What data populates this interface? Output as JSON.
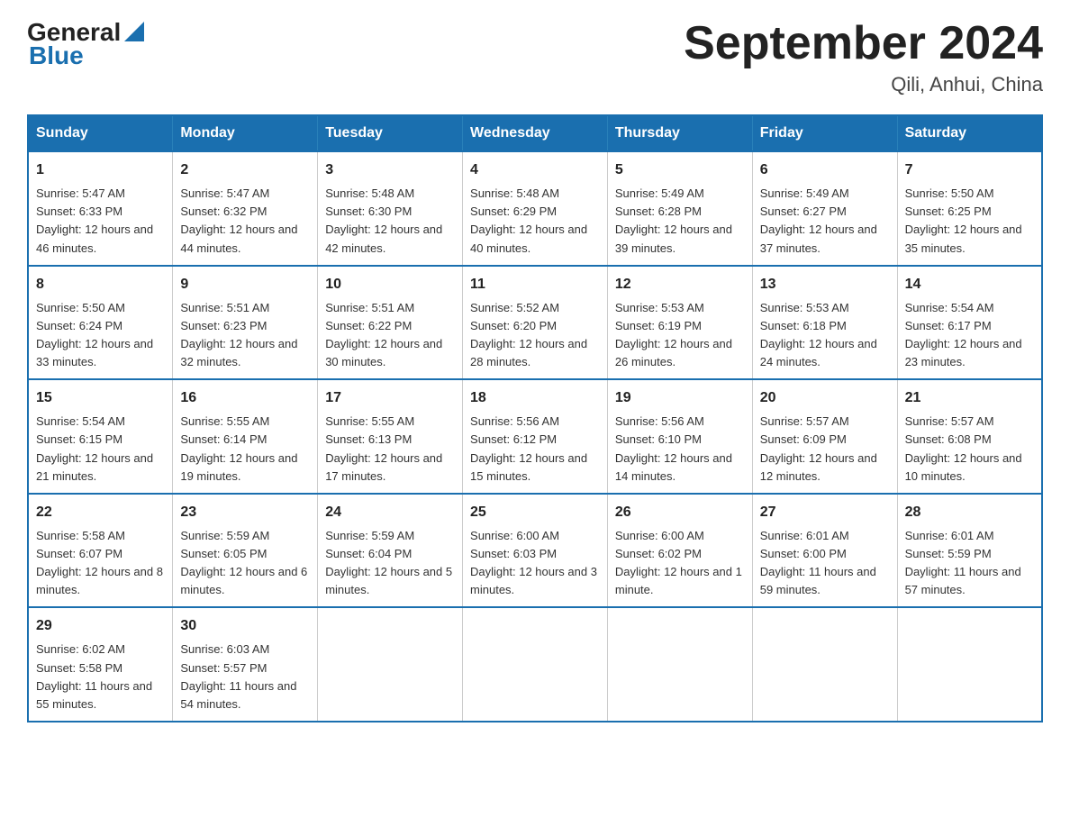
{
  "logo": {
    "text_general": "General",
    "text_blue": "Blue"
  },
  "title": "September 2024",
  "subtitle": "Qili, Anhui, China",
  "days_header": [
    "Sunday",
    "Monday",
    "Tuesday",
    "Wednesday",
    "Thursday",
    "Friday",
    "Saturday"
  ],
  "weeks": [
    [
      {
        "day": "1",
        "sunrise": "5:47 AM",
        "sunset": "6:33 PM",
        "daylight": "12 hours and 46 minutes."
      },
      {
        "day": "2",
        "sunrise": "5:47 AM",
        "sunset": "6:32 PM",
        "daylight": "12 hours and 44 minutes."
      },
      {
        "day": "3",
        "sunrise": "5:48 AM",
        "sunset": "6:30 PM",
        "daylight": "12 hours and 42 minutes."
      },
      {
        "day": "4",
        "sunrise": "5:48 AM",
        "sunset": "6:29 PM",
        "daylight": "12 hours and 40 minutes."
      },
      {
        "day": "5",
        "sunrise": "5:49 AM",
        "sunset": "6:28 PM",
        "daylight": "12 hours and 39 minutes."
      },
      {
        "day": "6",
        "sunrise": "5:49 AM",
        "sunset": "6:27 PM",
        "daylight": "12 hours and 37 minutes."
      },
      {
        "day": "7",
        "sunrise": "5:50 AM",
        "sunset": "6:25 PM",
        "daylight": "12 hours and 35 minutes."
      }
    ],
    [
      {
        "day": "8",
        "sunrise": "5:50 AM",
        "sunset": "6:24 PM",
        "daylight": "12 hours and 33 minutes."
      },
      {
        "day": "9",
        "sunrise": "5:51 AM",
        "sunset": "6:23 PM",
        "daylight": "12 hours and 32 minutes."
      },
      {
        "day": "10",
        "sunrise": "5:51 AM",
        "sunset": "6:22 PM",
        "daylight": "12 hours and 30 minutes."
      },
      {
        "day": "11",
        "sunrise": "5:52 AM",
        "sunset": "6:20 PM",
        "daylight": "12 hours and 28 minutes."
      },
      {
        "day": "12",
        "sunrise": "5:53 AM",
        "sunset": "6:19 PM",
        "daylight": "12 hours and 26 minutes."
      },
      {
        "day": "13",
        "sunrise": "5:53 AM",
        "sunset": "6:18 PM",
        "daylight": "12 hours and 24 minutes."
      },
      {
        "day": "14",
        "sunrise": "5:54 AM",
        "sunset": "6:17 PM",
        "daylight": "12 hours and 23 minutes."
      }
    ],
    [
      {
        "day": "15",
        "sunrise": "5:54 AM",
        "sunset": "6:15 PM",
        "daylight": "12 hours and 21 minutes."
      },
      {
        "day": "16",
        "sunrise": "5:55 AM",
        "sunset": "6:14 PM",
        "daylight": "12 hours and 19 minutes."
      },
      {
        "day": "17",
        "sunrise": "5:55 AM",
        "sunset": "6:13 PM",
        "daylight": "12 hours and 17 minutes."
      },
      {
        "day": "18",
        "sunrise": "5:56 AM",
        "sunset": "6:12 PM",
        "daylight": "12 hours and 15 minutes."
      },
      {
        "day": "19",
        "sunrise": "5:56 AM",
        "sunset": "6:10 PM",
        "daylight": "12 hours and 14 minutes."
      },
      {
        "day": "20",
        "sunrise": "5:57 AM",
        "sunset": "6:09 PM",
        "daylight": "12 hours and 12 minutes."
      },
      {
        "day": "21",
        "sunrise": "5:57 AM",
        "sunset": "6:08 PM",
        "daylight": "12 hours and 10 minutes."
      }
    ],
    [
      {
        "day": "22",
        "sunrise": "5:58 AM",
        "sunset": "6:07 PM",
        "daylight": "12 hours and 8 minutes."
      },
      {
        "day": "23",
        "sunrise": "5:59 AM",
        "sunset": "6:05 PM",
        "daylight": "12 hours and 6 minutes."
      },
      {
        "day": "24",
        "sunrise": "5:59 AM",
        "sunset": "6:04 PM",
        "daylight": "12 hours and 5 minutes."
      },
      {
        "day": "25",
        "sunrise": "6:00 AM",
        "sunset": "6:03 PM",
        "daylight": "12 hours and 3 minutes."
      },
      {
        "day": "26",
        "sunrise": "6:00 AM",
        "sunset": "6:02 PM",
        "daylight": "12 hours and 1 minute."
      },
      {
        "day": "27",
        "sunrise": "6:01 AM",
        "sunset": "6:00 PM",
        "daylight": "11 hours and 59 minutes."
      },
      {
        "day": "28",
        "sunrise": "6:01 AM",
        "sunset": "5:59 PM",
        "daylight": "11 hours and 57 minutes."
      }
    ],
    [
      {
        "day": "29",
        "sunrise": "6:02 AM",
        "sunset": "5:58 PM",
        "daylight": "11 hours and 55 minutes."
      },
      {
        "day": "30",
        "sunrise": "6:03 AM",
        "sunset": "5:57 PM",
        "daylight": "11 hours and 54 minutes."
      },
      {
        "day": "",
        "sunrise": "",
        "sunset": "",
        "daylight": ""
      },
      {
        "day": "",
        "sunrise": "",
        "sunset": "",
        "daylight": ""
      },
      {
        "day": "",
        "sunrise": "",
        "sunset": "",
        "daylight": ""
      },
      {
        "day": "",
        "sunrise": "",
        "sunset": "",
        "daylight": ""
      },
      {
        "day": "",
        "sunrise": "",
        "sunset": "",
        "daylight": ""
      }
    ]
  ]
}
